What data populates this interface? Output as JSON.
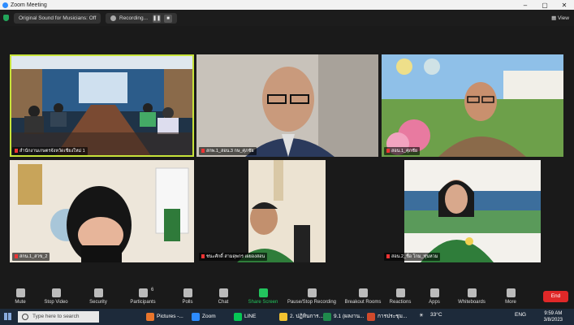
{
  "window": {
    "title": "Zoom Meeting"
  },
  "topbar": {
    "audio_pill": "Original Sound for Musicians: Off",
    "recording_label": "Recording...",
    "view_label": "View"
  },
  "participants": [
    {
      "name": "สำนักงานเกษตรจังหวัดเชียงใหม่ 1"
    },
    {
      "name": "สกพ.1_สอน.3 กษ_ศุภชัย"
    },
    {
      "name": "สอน.1_ศุภชัย"
    },
    {
      "name": "สกน.1_สวข_2"
    },
    {
      "name": "ชนะศักดิ์ สามดุพกร เผยองสอน"
    },
    {
      "name": "สอน.2_ชื่อ โกม_ทุ่นหวม"
    }
  ],
  "toolbar": {
    "mute": "Mute",
    "video": "Stop Video",
    "security": "Security",
    "participants": "Participants",
    "participants_count": "6",
    "polls": "Polls",
    "chat": "Chat",
    "share": "Share Screen",
    "record": "Pause/Stop Recording",
    "breakout": "Breakout Rooms",
    "reactions": "Reactions",
    "apps": "Apps",
    "whiteboards": "Whiteboards",
    "more": "More",
    "end": "End"
  },
  "taskbar": {
    "search_placeholder": "Type here to search",
    "apps": [
      "Pictures -...",
      "Zoom",
      "LINE",
      "2. ปฏิทินการ...",
      "9.1 (ผลงาน...",
      "การประชุม..."
    ],
    "temp": "33°C",
    "lang": "ENG",
    "time": "9:59 AM",
    "date": "3/8/2023"
  },
  "colors": {
    "accent_active": "#c7e33a",
    "end_red": "#e02828",
    "share_green": "#23c55e"
  }
}
